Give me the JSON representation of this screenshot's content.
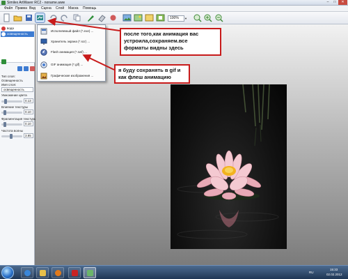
{
  "window": {
    "title": "Similex ArtWaver RC2 - noname.aww",
    "minimize": "–",
    "maximize": "□",
    "close": "✕"
  },
  "menu": [
    "Файл",
    "Правка",
    "Вид",
    "Сцена",
    "Слой",
    "Маска",
    "Помощь"
  ],
  "toolbar": {
    "zoom_value": "100%"
  },
  "layers": [
    {
      "name": "вода"
    },
    {
      "name": "освещенность"
    }
  ],
  "properties": {
    "type_label": "Тип слоя:",
    "type_value": "Освещенность",
    "name_label": "Имя слоя:",
    "name_value": "освещенность",
    "color_mult_label": "Умножение цвета",
    "color_mult_value": "0.13",
    "texture_effect_label": "Влияние текстуры",
    "texture_effect_value": "0.10",
    "texture_frag_label": "Фрагментация текстуры",
    "texture_frag_value": "0.10",
    "wave_freq_label": "Частота волны",
    "wave_freq_value": "3.85"
  },
  "export_menu": [
    {
      "label": "Исполняемый файл (*.exe) ...",
      "icon": "exe-file-icon"
    },
    {
      "label": "Хранитель экрана (*.scr) ...",
      "icon": "screensaver-icon"
    },
    {
      "label": "Flash анимация (*.swf) ...",
      "icon": "flash-icon"
    },
    {
      "label": "GIF анимация (*.gif) ...",
      "icon": "gif-icon"
    },
    {
      "label": "Графические изображения ...",
      "icon": "image-file-icon"
    }
  ],
  "callouts": {
    "top": "после того,как анимация вас\nустроила,сохраняем.все\nформаты видны здесь",
    "bottom": "я буду сохранять в gif и\nкак флеш анимацию"
  },
  "taskbar": {
    "lang": "RU",
    "time": "15:33",
    "date": "02.02.2012"
  },
  "colors": {
    "callout_border": "#c81b1b",
    "selection": "#3d7bd1",
    "taskbar": "#1f3654"
  }
}
